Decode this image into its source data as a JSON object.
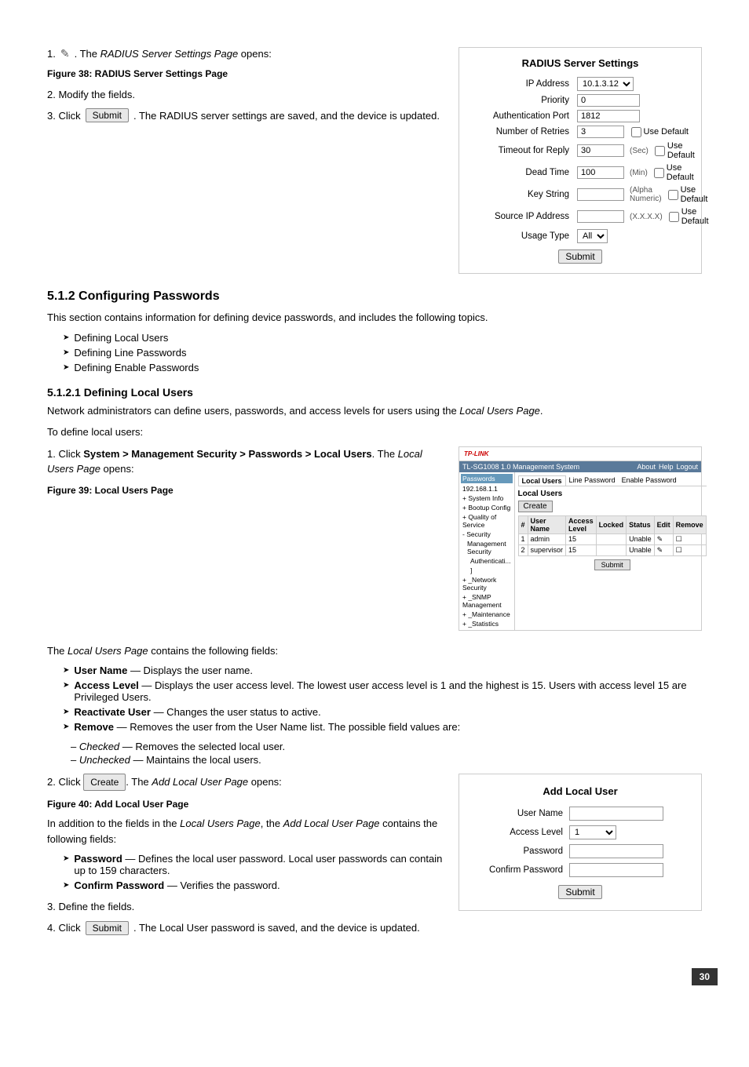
{
  "steps": {
    "step1_click": "1.",
    "step1_icon": "✎",
    "step1_text": ". The",
    "step1_italic": "RADIUS Server Settings Page",
    "step1_text2": "opens:",
    "figure38_label": "Figure 38: RADIUS Server Settings Page",
    "step2_text": "2.   Modify the fields.",
    "step3_click": "3.",
    "step3_btn": "Submit",
    "step3_text": ". The RADIUS server settings are saved, and the device is updated."
  },
  "radius_box": {
    "title": "RADIUS Server Settings",
    "ip_address_label": "IP Address",
    "ip_address_value": "10.1.3.12 ▼",
    "priority_label": "Priority",
    "priority_value": "0",
    "auth_port_label": "Authentication Port",
    "auth_port_value": "1812",
    "retries_label": "Number of Retries",
    "retries_value": "3",
    "retries_check": "Use Default",
    "timeout_label": "Timeout for Reply",
    "timeout_value": "30",
    "timeout_unit": "(Sec)",
    "timeout_check": "Use Default",
    "dead_time_label": "Dead Time",
    "dead_time_value": "100",
    "dead_time_unit": "(Min)",
    "dead_time_check": "Use Default",
    "key_label": "Key String",
    "key_note": "(Alpha Numeric)",
    "key_check": "Use Default",
    "source_label": "Source IP Address",
    "source_note": "(X.X.X.X)",
    "source_check": "Use Default",
    "usage_label": "Usage Type",
    "usage_value": "All",
    "submit_btn": "Submit"
  },
  "section512": {
    "title": "5.1.2  Configuring Passwords",
    "intro": "This section contains information for defining device passwords, and includes the following topics.",
    "bullets": [
      "Defining Local Users",
      "Defining Line Passwords",
      "Defining Enable Passwords"
    ]
  },
  "section5121": {
    "title": "5.1.2.1  Defining Local Users",
    "intro": "Network administrators can define users, passwords, and access levels for users using the",
    "intro_italic": "Local Users Page",
    "intro2": ".",
    "to_define": "To define local users:",
    "step1_num": "1.",
    "step1_pre": "Click",
    "step1_bold": "System > Management Security > Passwords > Local Users",
    "step1_post": ". The",
    "step1_italic": "Local Users Page",
    "step1_post2": "opens:",
    "figure39_label": "Figure 39: Local Users Page",
    "local_page_desc": "The",
    "local_page_italic": "Local Users Page",
    "local_page_post": "contains the following fields:",
    "fields": [
      {
        "bold": "User Name",
        "text": "— Displays the user name."
      },
      {
        "bold": "Access Level",
        "text": "— Displays the user access level. The lowest user access level is 1 and the highest is 15. Users with access level 15 are Privileged Users."
      },
      {
        "bold": "Reactivate User",
        "text": "— Changes the user status to active."
      },
      {
        "bold": "Remove",
        "text": "— Removes the user from the User Name list. The possible field values are:"
      }
    ],
    "remove_sub": [
      "Checked — Removes the selected local user.",
      "Unchecked — Maintains the local users."
    ],
    "step2_num": "2.",
    "step2_click": "Create",
    "step2_post": ". The",
    "step2_italic": "Add Local User Page",
    "step2_post2": "opens:",
    "figure40_label": "Figure 40: Add Local User Page",
    "add_intro": "In addition to the fields in the",
    "add_italic": "Local Users Page",
    "add_post": ", the",
    "add_italic2": "Add Local User Page",
    "add_post2": "contains the following fields:",
    "add_fields": [
      {
        "bold": "Password",
        "text": "— Defines the local user password. Local user passwords can contain up to 159 characters."
      },
      {
        "bold": "Confirm Password",
        "text": "— Verifies the password."
      }
    ],
    "step3_text": "3.   Define the fields.",
    "step4_num": "4.",
    "step4_click": "Submit",
    "step4_text": ". The Local User password is saved, and the device is updated."
  },
  "device_nav": {
    "items": [
      "Passwords",
      "About",
      "Help",
      "Logout"
    ],
    "tabs": [
      "Local Users",
      "Line Password",
      "Enable Password"
    ]
  },
  "device_sidebar": {
    "items": [
      "192.168.1.1",
      "+ System Info",
      "+ Bootup Config",
      "+ Quality of Service",
      "- Security",
      "  Management Security",
      "  Authenticati...",
      "  ]",
      " + _Network Security",
      " + _SNMP Management",
      " + _Maintenance",
      " + _Statistics"
    ]
  },
  "device_table": {
    "headers": [
      "#",
      "User Name",
      "Access Level",
      "Locked",
      "Status",
      "Edit",
      "Remove"
    ],
    "rows": [
      [
        "1",
        "admin",
        "15",
        "",
        "Unable",
        "✎",
        "☐"
      ],
      [
        "2",
        "supervisor",
        "15",
        "",
        "Unable",
        "✎",
        "☐"
      ]
    ],
    "create_btn": "Create",
    "submit_btn": "Submit"
  },
  "add_user_box": {
    "title": "Add Local User",
    "user_name_label": "User Name",
    "access_level_label": "Access Level",
    "access_level_value": "1 ▼",
    "password_label": "Password",
    "confirm_label": "Confirm Password",
    "submit_btn": "Submit"
  },
  "page_number": "30"
}
